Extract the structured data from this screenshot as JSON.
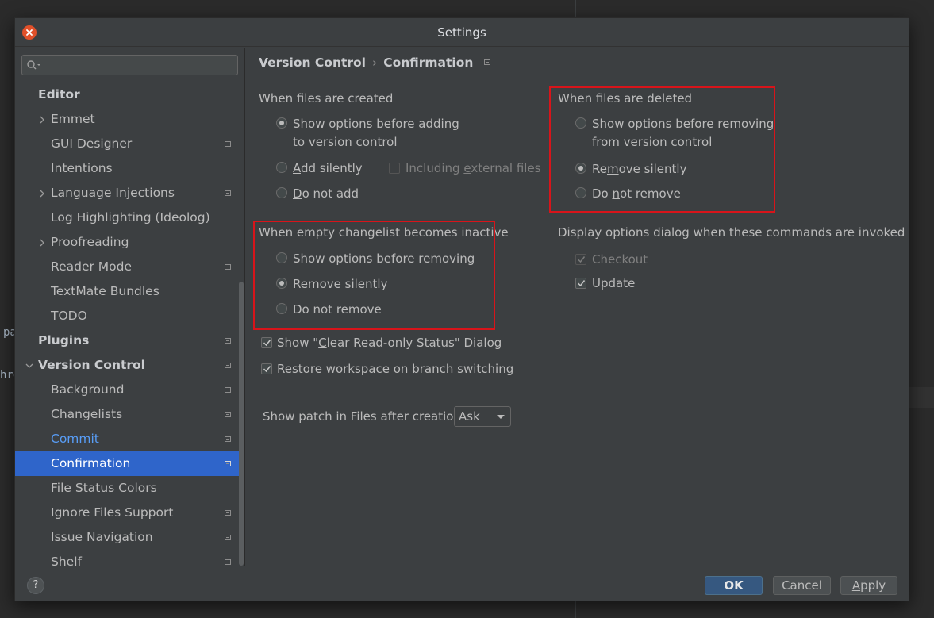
{
  "window": {
    "title": "Settings"
  },
  "background": {
    "text_a": "pa",
    "text_b": "hre"
  },
  "sidebar": {
    "search_placeholder": "",
    "items": [
      {
        "label": "Editor"
      },
      {
        "label": "Emmet"
      },
      {
        "label": "GUI Designer"
      },
      {
        "label": "Intentions"
      },
      {
        "label": "Language Injections"
      },
      {
        "label": "Log Highlighting (Ideolog)"
      },
      {
        "label": "Proofreading"
      },
      {
        "label": "Reader Mode"
      },
      {
        "label": "TextMate Bundles"
      },
      {
        "label": "TODO"
      },
      {
        "label": "Plugins"
      },
      {
        "label": "Version Control"
      },
      {
        "label": "Background"
      },
      {
        "label": "Changelists"
      },
      {
        "label": "Commit"
      },
      {
        "label": "Confirmation"
      },
      {
        "label": "File Status Colors"
      },
      {
        "label": "Ignore Files Support"
      },
      {
        "label": "Issue Navigation"
      },
      {
        "label": "Shelf"
      }
    ]
  },
  "breadcrumb": {
    "parent": "Version Control",
    "separator": "›",
    "current": "Confirmation"
  },
  "files_created": {
    "title": "When files are created",
    "opt_show_line1": "Show options before adding",
    "opt_show_line2": "to version control",
    "opt_add_mn": "A",
    "opt_add_rest": "dd silently",
    "opt_including_pre": "Including ",
    "opt_including_mn": "e",
    "opt_including_post": "xternal files",
    "opt_donot_mn": "D",
    "opt_donot_rest": "o not add"
  },
  "files_deleted": {
    "title": "When files are deleted",
    "opt_show_line1": "Show options before removing",
    "opt_show_line2": "from version control",
    "opt_remove_pre": "Re",
    "opt_remove_mn": "m",
    "opt_remove_post": "ove silently",
    "opt_donot_pre": "Do ",
    "opt_donot_mn": "n",
    "opt_donot_post": "ot remove"
  },
  "changelist": {
    "title": "When empty changelist becomes inactive",
    "opt_show": "Show options before removing",
    "opt_remove": "Remove silently",
    "opt_donot": "Do not remove"
  },
  "display_options": {
    "title": "Display options dialog when these commands are invoked",
    "checkout": "Checkout",
    "update": "Update"
  },
  "clear_readonly": {
    "pre": "Show \"",
    "mn": "C",
    "post": "lear Read-only Status\" Dialog"
  },
  "restore_ws": {
    "pre": "Restore workspace on ",
    "mn": "b",
    "post": "ranch switching"
  },
  "patch": {
    "label": "Show patch in Files after creation:",
    "value": "Ask"
  },
  "footer": {
    "help": "?",
    "ok": "OK",
    "cancel": "Cancel",
    "apply_mn": "A",
    "apply_rest": "pply"
  },
  "colors": {
    "accent": "#2f65ca",
    "highlight_box": "#d8141a",
    "link": "#589df6"
  }
}
